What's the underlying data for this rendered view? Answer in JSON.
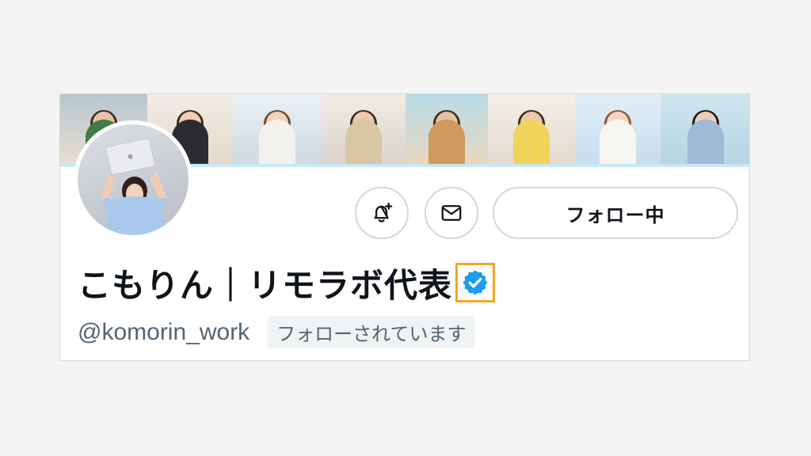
{
  "profile": {
    "display_name": "こもりん｜リモラボ代表",
    "handle": "@komorin_work",
    "follows_you_label": "フォローされています",
    "verified": true
  },
  "actions": {
    "notify_icon": "bell-plus-icon",
    "message_icon": "envelope-icon",
    "follow_label": "フォロー中"
  },
  "colors": {
    "verified_badge": "#1d9bf0",
    "highlight_border": "#f5a623",
    "secondary_text": "#536471",
    "banner_underline": "#c9e8f7"
  }
}
